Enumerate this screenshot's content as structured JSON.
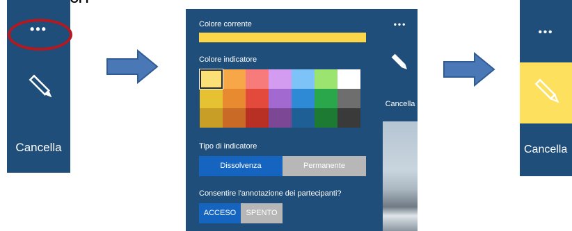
{
  "top_fragment": "OK o OFF",
  "step1": {
    "menu_label": "•••",
    "cancella_label": "Cancella"
  },
  "panel": {
    "current_color_label": "Colore corrente",
    "current_color": "#fad84a",
    "indicator_color_label": "Colore indicatore",
    "palette": [
      [
        "#fbe078",
        "#f7a748",
        "#f77b7b",
        "#d39cf0",
        "#7ec3f7",
        "#9be46f",
        "#ffffff"
      ],
      [
        "#e6c233",
        "#e88a30",
        "#e34a3c",
        "#a26ad0",
        "#2f8ad6",
        "#2aa74a",
        "#6e6e6e"
      ],
      [
        "#c99e26",
        "#c96a26",
        "#b82f23",
        "#7c4895",
        "#1e5f96",
        "#1c7a33",
        "#3a3a3a"
      ]
    ],
    "indicator_type_label": "Tipo di indicatore",
    "type_options": [
      "Dissolvenza",
      "Permanente"
    ],
    "allow_label": "Consentire l'annotazione dei partecipanti?",
    "allow_options": [
      "ACCESO",
      "SPENTO"
    ],
    "side_menu_label": "•••",
    "side_cancella_label": "Cancella"
  },
  "step3": {
    "menu_label": "•••",
    "cancella_label": "Cancella"
  },
  "colors": {
    "toolbar_blue": "#1f4e7a",
    "highlight_red": "#b3191f",
    "arrow_blue": "#4a78b6",
    "selected_blue": "#1565c0",
    "gray": "#b7b7b7",
    "selected_yellow": "#fde15e"
  }
}
